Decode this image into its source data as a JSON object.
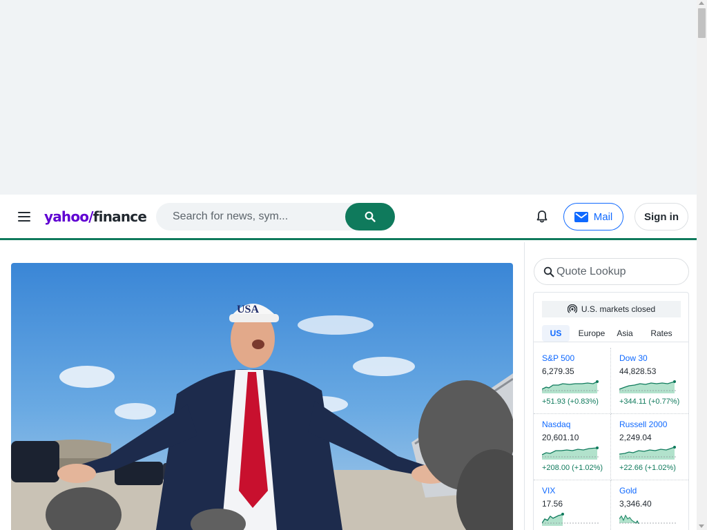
{
  "header": {
    "logo": {
      "yahoo": "yahoo",
      "slash": "/",
      "finance": "finance"
    },
    "search_placeholder": "Search for news, sym...",
    "mail_label": "Mail",
    "signin_label": "Sign in"
  },
  "sidebar": {
    "quote_placeholder": "Quote Lookup",
    "market_status": "U.S. markets closed",
    "region_tabs": [
      "US",
      "Europe",
      "Asia",
      "Rates"
    ],
    "active_region": "US",
    "tiles": [
      {
        "name": "S&P 500",
        "value": "6,279.35",
        "change": "+51.93",
        "pct": "(+0.83%)"
      },
      {
        "name": "Dow 30",
        "value": "44,828.53",
        "change": "+344.11",
        "pct": "(+0.77%)"
      },
      {
        "name": "Nasdaq",
        "value": "20,601.10",
        "change": "+208.00",
        "pct": "(+1.02%)"
      },
      {
        "name": "Russell 2000",
        "value": "2,249.04",
        "change": "+22.66",
        "pct": "(+1.02%)"
      },
      {
        "name": "VIX",
        "value": "17.56",
        "change": "",
        "pct": ""
      },
      {
        "name": "Gold",
        "value": "3,346.40",
        "change": "",
        "pct": ""
      }
    ]
  },
  "colors": {
    "brand_green": "#0f7a5c",
    "link_blue": "#0f69ff",
    "yahoo_purple": "#6001d2",
    "ad_bg": "#f0f3f5"
  },
  "icons": {
    "menu": "hamburger-icon",
    "search": "search-icon",
    "bell": "bell-icon",
    "mail": "envelope-icon",
    "market_status": "broadcast-icon"
  }
}
